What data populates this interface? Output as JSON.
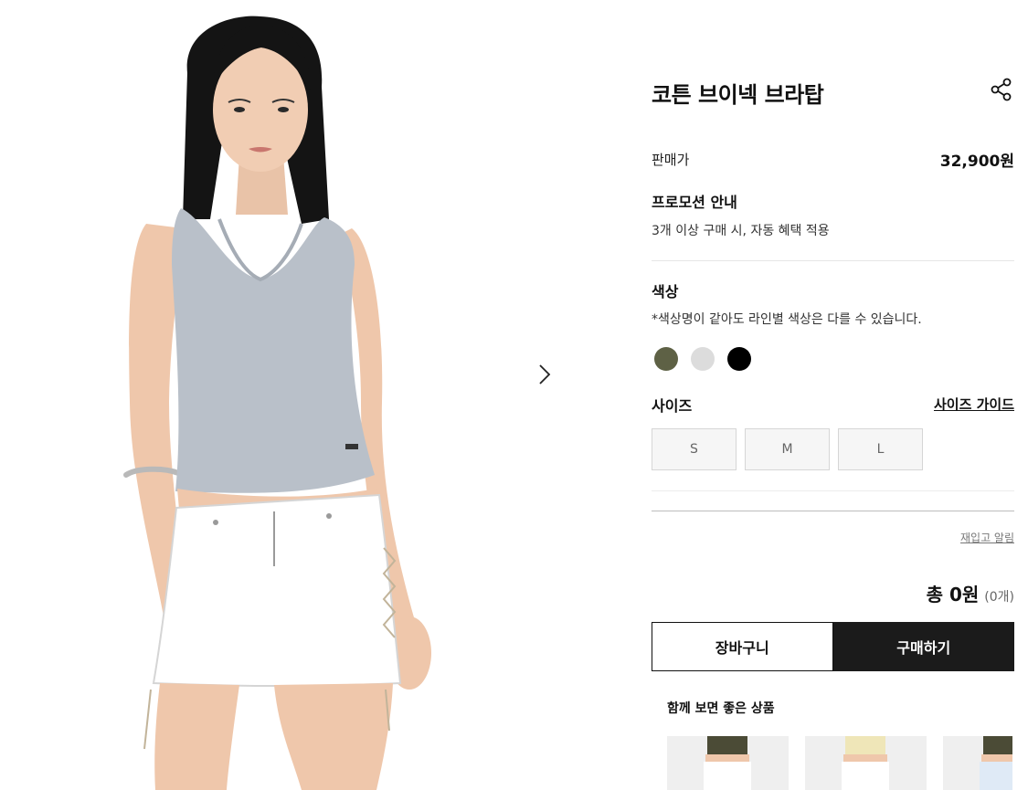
{
  "product": {
    "title": "코튼 브이넥 브라탑",
    "price_label": "판매가",
    "price_value": "32,900원"
  },
  "promotion": {
    "title": "프로모션 안내",
    "description": "3개 이상 구매 시, 자동 혜택 적용"
  },
  "color": {
    "title": "색상",
    "note": "*색상명이 같아도 라인별 색상은 다를 수 있습니다.",
    "swatches": [
      "#5e6145",
      "#dcdcdc",
      "#000000"
    ]
  },
  "size": {
    "title": "사이즈",
    "guide_label": "사이즈 가이드",
    "options": [
      "S",
      "M",
      "L"
    ]
  },
  "restock_label": "재입고 알림",
  "total": {
    "label": "총 0원",
    "count": "(0개)"
  },
  "actions": {
    "cart_label": "장바구니",
    "buy_label": "구매하기"
  },
  "recommend": {
    "title": "함께 보면 좋은 상품",
    "top_colors": [
      "#4b4b36",
      "#efe6b8",
      "#4b4b36"
    ]
  },
  "icons": {
    "share": "share-icon",
    "next": "chevron-right-icon"
  }
}
